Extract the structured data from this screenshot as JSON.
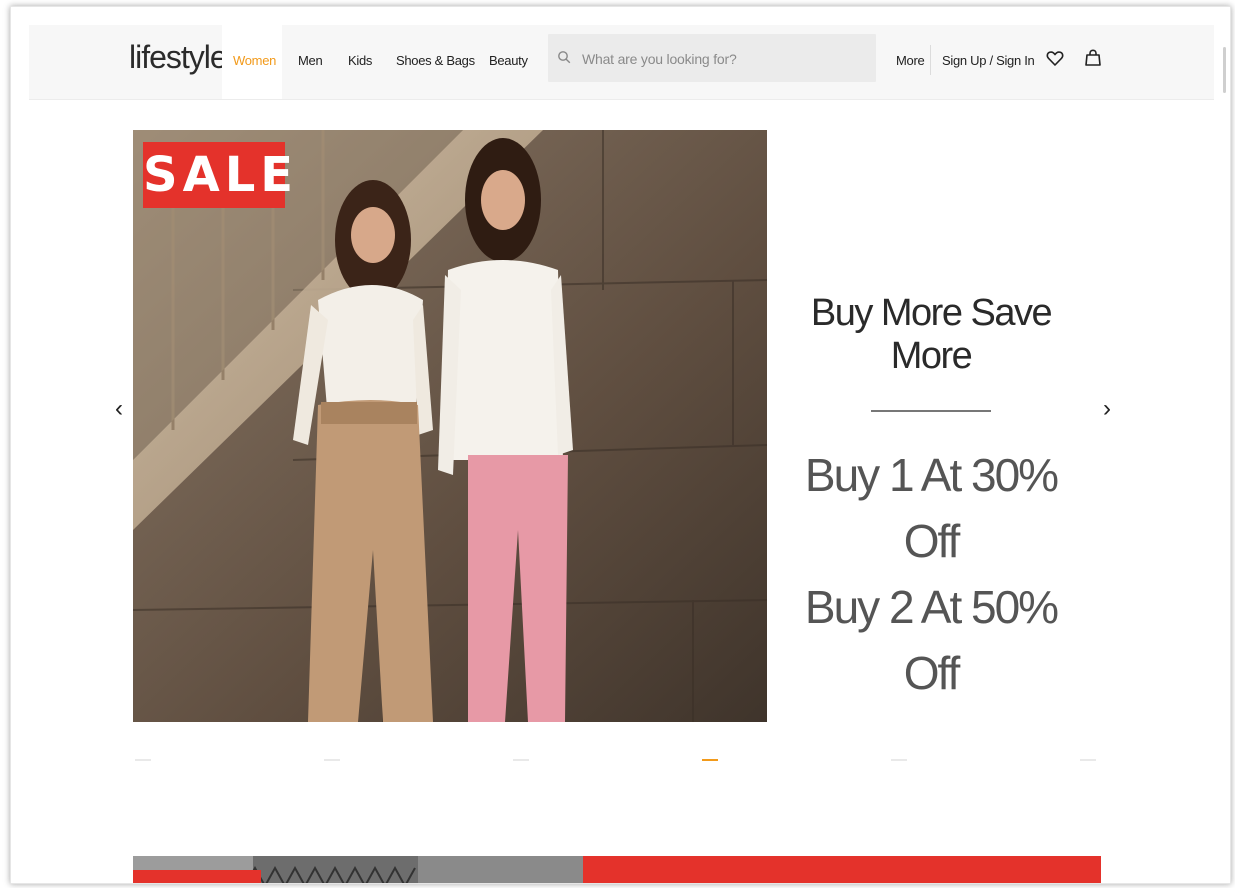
{
  "header": {
    "logo": "lifestyle",
    "nav": [
      {
        "label": "Women",
        "active": true
      },
      {
        "label": "Men"
      },
      {
        "label": "Kids"
      },
      {
        "label": "Shoes & Bags"
      },
      {
        "label": "Beauty"
      }
    ],
    "search_placeholder": "What are you looking for?",
    "more": "More",
    "signin": "Sign Up / Sign In",
    "icons": {
      "search": "search-icon",
      "wishlist": "heart-icon",
      "bag": "shopping-bag-icon"
    }
  },
  "hero": {
    "badge": "SALE",
    "promo_title": "Buy More Save More",
    "promo_lines": [
      "Buy 1 At 30% Off",
      "Buy 2 At 50% Off"
    ],
    "prev_icon": "‹",
    "next_icon": "›",
    "slide_count": 6,
    "active_slide": 4
  },
  "colors": {
    "accent": "#f29a1b",
    "sale_red": "#e4322b",
    "text": "#222222"
  }
}
